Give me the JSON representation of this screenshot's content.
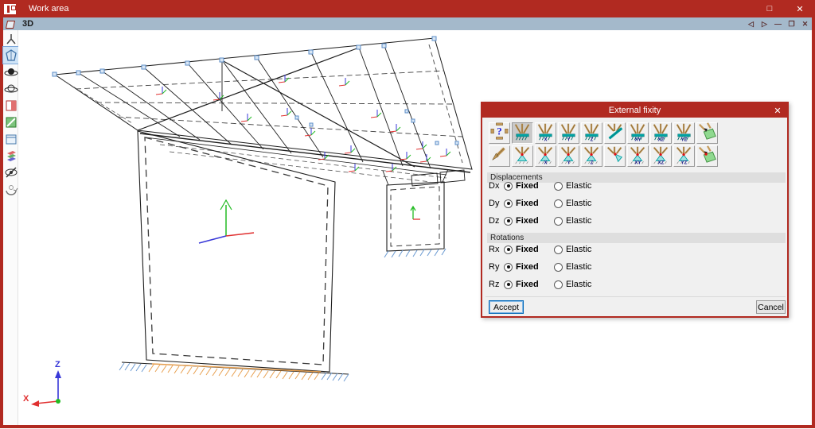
{
  "window": {
    "title": "Work area",
    "maximize_glyph": "□",
    "close_glyph": "✕"
  },
  "viewport": {
    "title": "3D",
    "back_glyph": "◁",
    "forward_glyph": "▷",
    "minimize_glyph": "—",
    "restore_glyph": "❐",
    "close_glyph": "✕"
  },
  "left_toolbar": {
    "items": [
      {
        "name": "set-square-icon",
        "selected": false
      },
      {
        "name": "view-3d-icon",
        "selected": true
      },
      {
        "name": "orbit-solid-icon",
        "selected": false
      },
      {
        "name": "orbit-wire-icon",
        "selected": false
      },
      {
        "name": "split-window-icon",
        "selected": false
      },
      {
        "name": "section-plane-icon",
        "selected": false
      },
      {
        "name": "window-frame-icon",
        "selected": false
      },
      {
        "name": "layers-icon",
        "selected": false
      },
      {
        "name": "hide-elements-icon",
        "selected": false
      },
      {
        "name": "rotate-3d-icon",
        "selected": false
      }
    ]
  },
  "axes_indicator": {
    "x_label": "X",
    "z_label": "Z"
  },
  "dialog": {
    "title": "External fixity",
    "close_glyph": "✕",
    "support_buttons": [
      [
        {
          "name": "support-unknown-icon",
          "kind": "question",
          "axis": "",
          "selected": false
        },
        {
          "name": "support-fixed-icon",
          "kind": "fixed",
          "axis": "",
          "selected": true
        },
        {
          "name": "support-fixed-x-icon",
          "kind": "fixed",
          "axis": "X",
          "selected": false
        },
        {
          "name": "support-fixed-y-icon",
          "kind": "fixed",
          "axis": "Y",
          "selected": false
        },
        {
          "name": "support-fixed-z-icon",
          "kind": "fixed",
          "axis": "Z",
          "selected": false
        },
        {
          "name": "support-fixed-rotated-icon",
          "kind": "fixed-rot",
          "axis": "",
          "selected": false
        },
        {
          "name": "support-fixed-xy-icon",
          "kind": "fixed",
          "axis": "XY",
          "selected": false
        },
        {
          "name": "support-fixed-xz-icon",
          "kind": "fixed",
          "axis": "XZ",
          "selected": false
        },
        {
          "name": "support-fixed-yz-icon",
          "kind": "fixed",
          "axis": "YZ",
          "selected": false
        },
        {
          "name": "support-fixed-plane-icon",
          "kind": "plane-fixed",
          "axis": "",
          "selected": false
        }
      ],
      [
        {
          "name": "support-corner-icon",
          "kind": "corner",
          "axis": "",
          "selected": false
        },
        {
          "name": "support-pinned-icon",
          "kind": "pinned",
          "axis": "",
          "selected": false
        },
        {
          "name": "support-pinned-x-icon",
          "kind": "pinned",
          "axis": "X",
          "selected": false
        },
        {
          "name": "support-pinned-y-icon",
          "kind": "pinned",
          "axis": "Y",
          "selected": false
        },
        {
          "name": "support-pinned-z-icon",
          "kind": "pinned",
          "axis": "Z",
          "selected": false
        },
        {
          "name": "support-pinned-rotated-icon",
          "kind": "pinned-rot",
          "axis": "",
          "selected": false
        },
        {
          "name": "support-pinned-xy-icon",
          "kind": "pinned",
          "axis": "XY",
          "selected": false
        },
        {
          "name": "support-pinned-xz-icon",
          "kind": "pinned",
          "axis": "XZ",
          "selected": false
        },
        {
          "name": "support-pinned-yz-icon",
          "kind": "pinned",
          "axis": "YZ",
          "selected": false
        },
        {
          "name": "support-pinned-plane-icon",
          "kind": "plane-pinned",
          "axis": "",
          "selected": false
        }
      ]
    ],
    "sections": [
      {
        "title": "Displacements",
        "rows": [
          {
            "label": "Dx",
            "fixed_label": "Fixed",
            "elastic_label": "Elastic",
            "selected": "fixed"
          },
          {
            "label": "Dy",
            "fixed_label": "Fixed",
            "elastic_label": "Elastic",
            "selected": "fixed"
          },
          {
            "label": "Dz",
            "fixed_label": "Fixed",
            "elastic_label": "Elastic",
            "selected": "fixed"
          }
        ]
      },
      {
        "title": "Rotations",
        "rows": [
          {
            "label": "Rx",
            "fixed_label": "Fixed",
            "elastic_label": "Elastic",
            "selected": "fixed"
          },
          {
            "label": "Ry",
            "fixed_label": "Fixed",
            "elastic_label": "Elastic",
            "selected": "fixed"
          },
          {
            "label": "Rz",
            "fixed_label": "Fixed",
            "elastic_label": "Elastic",
            "selected": "fixed"
          }
        ]
      }
    ],
    "accept_label": "Accept",
    "cancel_label": "Cancel"
  },
  "colors": {
    "titlebar": "#B12A21",
    "mdi_bar": "#A4B9CB",
    "focus_accent": "#0067B8",
    "support_tan": "#C49A5A",
    "support_teal": "#00A3A3",
    "plane_green": "#8FD98F",
    "hatch_blue": "#6C9BD2",
    "hatch_orange": "#E8A050",
    "node_blue": "#5B8DC8"
  }
}
